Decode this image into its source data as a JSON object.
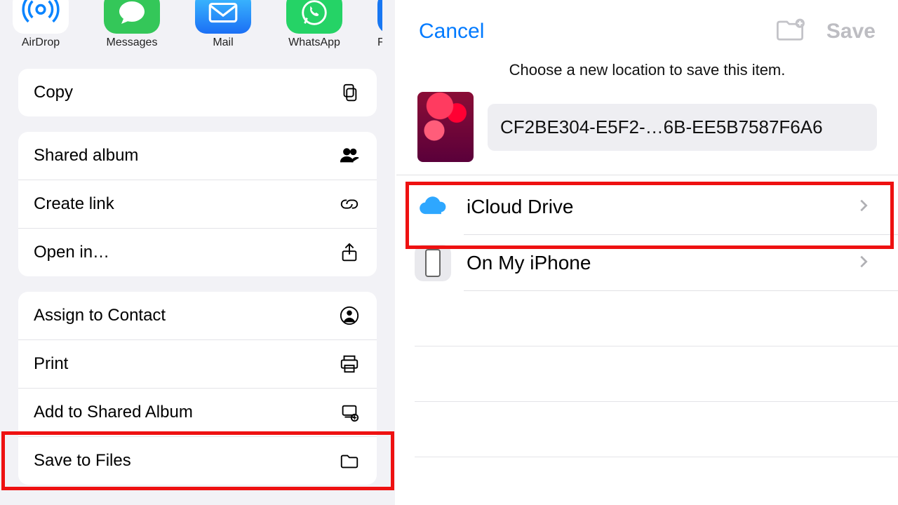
{
  "share": {
    "apps": {
      "airdrop": "AirDrop",
      "messages": "Messages",
      "mail": "Mail",
      "whatsapp": "WhatsApp",
      "facebook": "Fa"
    },
    "copy": "Copy",
    "shared_album": "Shared album",
    "create_link": "Create link",
    "open_in": "Open in…",
    "assign_contact": "Assign to Contact",
    "print": "Print",
    "add_shared_album": "Add to Shared Album",
    "save_to_files": "Save to Files"
  },
  "files": {
    "cancel": "Cancel",
    "save": "Save",
    "subtitle": "Choose a new location to save this item.",
    "filename": "CF2BE304-E5F2-…6B-EE5B7587F6A6",
    "locations": {
      "icloud": "iCloud Drive",
      "iphone": "On My iPhone"
    }
  }
}
